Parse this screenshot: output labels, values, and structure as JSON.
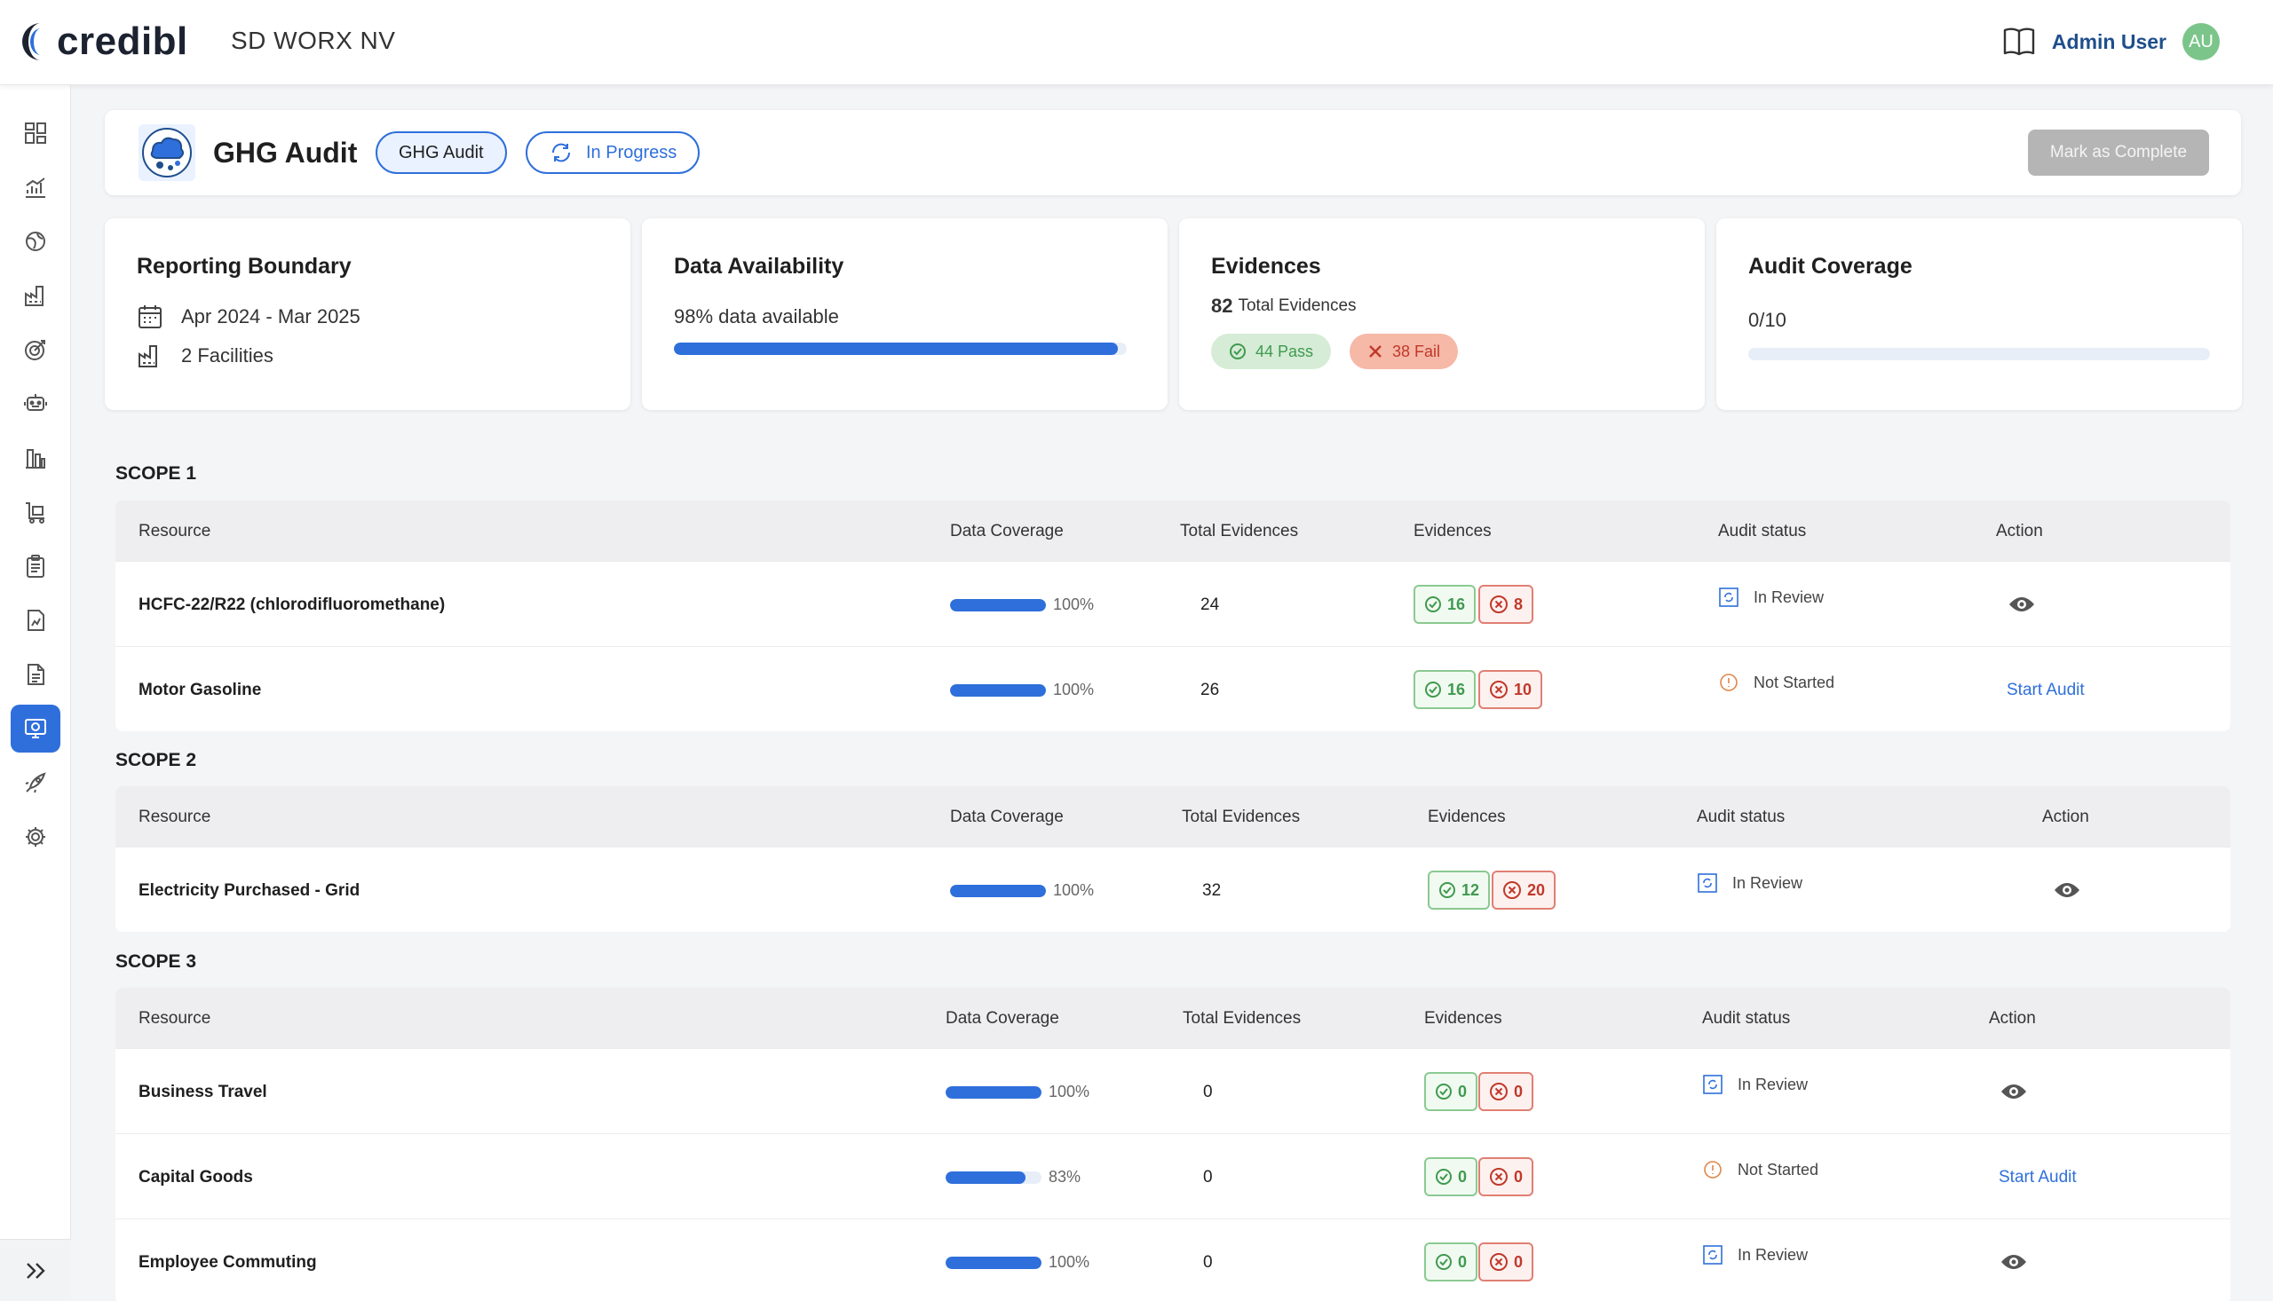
{
  "app": {
    "logo_text": "credibl",
    "org_name": "SD WORX NV"
  },
  "user": {
    "name": "Admin User",
    "initials": "AU"
  },
  "sidebar": {
    "items": [
      {
        "icon": "dashboard-icon"
      },
      {
        "icon": "chart-icon"
      },
      {
        "icon": "globe-icon"
      },
      {
        "icon": "factory-icon"
      },
      {
        "icon": "target-icon"
      },
      {
        "icon": "robot-icon"
      },
      {
        "icon": "buildings-icon"
      },
      {
        "icon": "cart-icon"
      },
      {
        "icon": "clipboard-icon"
      },
      {
        "icon": "report-icon"
      },
      {
        "icon": "document-icon"
      },
      {
        "icon": "audit-icon",
        "active": true
      },
      {
        "icon": "rocket-icon"
      },
      {
        "icon": "gear-icon"
      }
    ]
  },
  "header": {
    "title": "GHG Audit",
    "type_label": "GHG Audit",
    "status_label": "In Progress",
    "complete_button": "Mark as Complete"
  },
  "stats": {
    "boundary": {
      "title": "Reporting Boundary",
      "period": "Apr 2024 - Mar 2025",
      "facilities": "2 Facilities"
    },
    "availability": {
      "title": "Data Availability",
      "text": "98% data available",
      "percent": 98
    },
    "evidences": {
      "title": "Evidences",
      "total": "82",
      "total_label": "Total Evidences",
      "pass": "44 Pass",
      "fail": "38 Fail"
    },
    "coverage": {
      "title": "Audit Coverage",
      "text": "0/10",
      "percent": 0
    }
  },
  "columns": {
    "resource": "Resource",
    "coverage": "Data Coverage",
    "total": "Total Evidences",
    "evidences": "Evidences",
    "status": "Audit status",
    "action": "Action"
  },
  "scope1": {
    "label": "SCOPE 1",
    "rows": [
      {
        "resource": "HCFC-22/R22 (chlorodifluoromethane)",
        "coverage": "100%",
        "coverage_pct": 100,
        "total": "24",
        "pass": "16",
        "fail": "8",
        "status": "In Review",
        "action": "view"
      },
      {
        "resource": "Motor Gasoline",
        "coverage": "100%",
        "coverage_pct": 100,
        "total": "26",
        "pass": "16",
        "fail": "10",
        "status": "Not Started",
        "action": "Start Audit"
      }
    ]
  },
  "scope2": {
    "label": "SCOPE 2",
    "rows": [
      {
        "resource": "Electricity Purchased - Grid",
        "coverage": "100%",
        "coverage_pct": 100,
        "total": "32",
        "pass": "12",
        "fail": "20",
        "status": "In Review",
        "action": "view"
      }
    ]
  },
  "scope3": {
    "label": "SCOPE 3",
    "rows": [
      {
        "resource": "Business Travel",
        "coverage": "100%",
        "coverage_pct": 100,
        "total": "0",
        "pass": "0",
        "fail": "0",
        "status": "In Review",
        "action": "view"
      },
      {
        "resource": "Capital Goods",
        "coverage": "83%",
        "coverage_pct": 83,
        "total": "0",
        "pass": "0",
        "fail": "0",
        "status": "Not Started",
        "action": "Start Audit"
      },
      {
        "resource": "Employee Commuting",
        "coverage": "100%",
        "coverage_pct": 100,
        "total": "0",
        "pass": "0",
        "fail": "0",
        "status": "In Review",
        "action": "view"
      }
    ]
  },
  "colors": {
    "accent": "#2f6fdb",
    "pass": "#3f9a4f",
    "fail": "#c0392b",
    "user": "#1f4e8c"
  }
}
